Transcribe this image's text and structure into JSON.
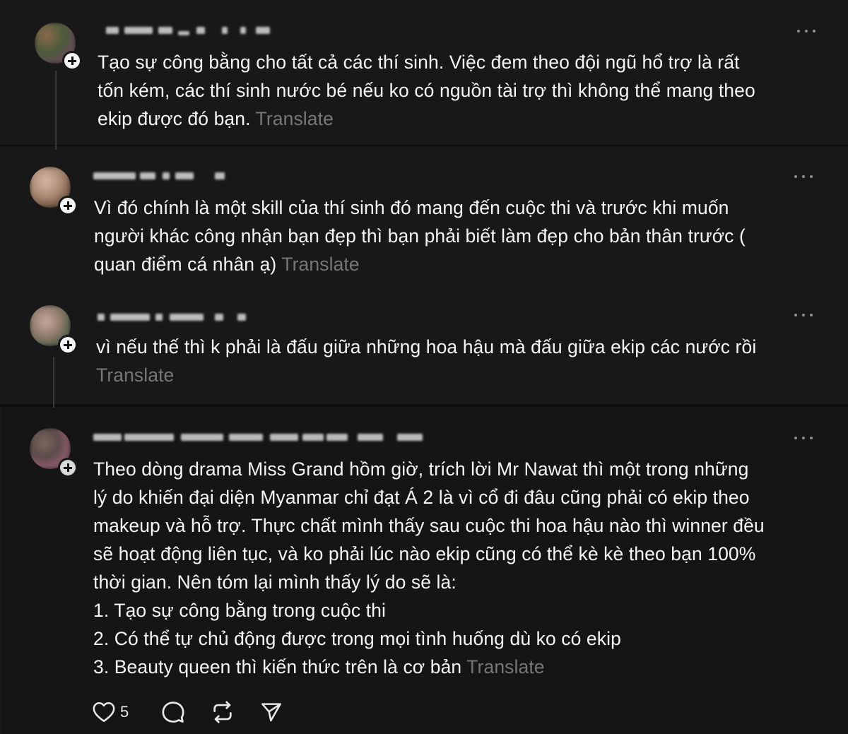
{
  "posts": [
    {
      "text": "Tạo sự công bằng cho tất cả các thí sinh. Việc đem theo đội ngũ hổ trợ là rất\ntốn kém, các thí sinh nước bé nếu ko có nguồn tài trợ thì không thể mang theo\nekip được đó bạn. ",
      "translate": "Translate"
    },
    {
      "text": "Vì đó chính là một skill của thí sinh đó mang đến cuộc thi và trước khi muốn\nngười khác công nhận bạn đẹp thì bạn phải biết làm đẹp cho bản thân trước (\nquan điểm cá nhân ạ) ",
      "translate": "Translate"
    },
    {
      "text": "vì nếu thế thì k phải là đấu giữa những hoa hậu mà đấu giữa ekip các nước rồi\n",
      "translate": "Translate"
    },
    {
      "text": "Theo dòng drama Miss Grand hồm giờ, trích lời Mr Nawat thì một trong những\nlý do khiến đại diện Myanmar chỉ đạt Á 2 là vì cổ đi đâu cũng phải có ekip theo\nmakeup và hỗ trợ. Thực chất mình thấy sau cuộc thi hoa hậu nào thì winner đều\nsẽ hoạt động liên tục, và ko phải lúc nào ekip cũng có thể kè kè theo bạn 100%\nthời gian. Nên tóm lại mình thấy lý do sẽ là:\n1. Tạo sự công bằng trong cuộc thi\n2. Có thể tự chủ động được trong mọi tình huống dù ko có ekip\n3. Beauty queen thì kiến thức trên là cơ bản ",
      "translate": "Translate",
      "like_count": "5"
    }
  ],
  "icons": {
    "more": "more-horizontal-icon",
    "follow": "plus-icon",
    "like": "heart-icon",
    "reply": "comment-icon",
    "repost": "repost-icon",
    "share": "send-icon"
  },
  "colors": {
    "background": "#181818",
    "text": "#f3f5f7",
    "muted": "#777777"
  }
}
